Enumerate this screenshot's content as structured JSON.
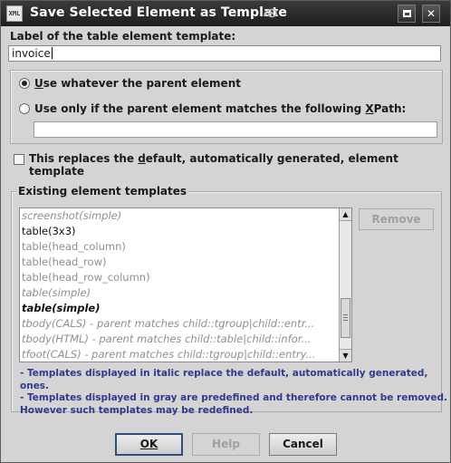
{
  "window": {
    "title": "Save Selected Element as Template",
    "icon_text": "XML"
  },
  "label_field": {
    "label": "Label of the table element template:",
    "value": "invoice"
  },
  "parent_options": {
    "option1": {
      "pre": "",
      "mnemonic": "U",
      "post": "se whatever the parent element",
      "selected": true
    },
    "option2": {
      "pre": "Use only if the parent element matches the following ",
      "mnemonic": "X",
      "post": "Path:",
      "selected": false
    },
    "xpath_value": ""
  },
  "replace_checkbox": {
    "pre": "This replaces the ",
    "mnemonic": "d",
    "post": "efault, automatically generated, element template",
    "checked": false
  },
  "existing": {
    "legend": "Existing element templates",
    "items": [
      {
        "text": "screenshot(simple)"
      },
      {
        "text": "table(3x3)"
      },
      {
        "text": "table(head_column)"
      },
      {
        "text": "table(head_row)"
      },
      {
        "text": "table(head_row_column)"
      },
      {
        "text": "table(simple)"
      },
      {
        "text": "table(simple)"
      },
      {
        "text": "tbody(CALS) - parent matches child::tgroup|child::entr..."
      },
      {
        "text": "tbody(HTML) - parent matches child::table|child::infor..."
      },
      {
        "text": "tfoot(CALS) - parent matches child::tgroup|child::entry..."
      }
    ],
    "remove_label": "Remove",
    "notes": [
      "- Templates displayed in italic replace the default, automatically generated, ones.",
      "- Templates displayed in gray are predefined and therefore cannot be removed.",
      "However such templates may be redefined."
    ]
  },
  "buttons": {
    "ok": "OK",
    "help": "Help",
    "cancel": "Cancel"
  },
  "colors": {
    "titlebar": "#2b2b2b",
    "notes_text": "#2f3a8c",
    "predefined_gray": "#8f8f8f"
  }
}
